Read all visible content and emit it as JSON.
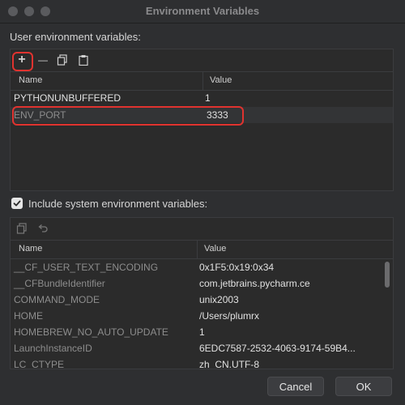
{
  "window": {
    "title": "Environment Variables"
  },
  "user_section": {
    "label": "User environment variables:",
    "toolbar": {
      "add": "+",
      "remove": "—",
      "copy": "copy",
      "paste": "paste"
    },
    "columns": {
      "name": "Name",
      "value": "Value"
    },
    "rows": [
      {
        "name": "PYTHONUNBUFFERED",
        "value": "1"
      },
      {
        "name": "ENV_PORT",
        "value": "3333"
      }
    ]
  },
  "system_section": {
    "checkbox_label": "Include system environment variables:",
    "checked": true,
    "columns": {
      "name": "Name",
      "value": "Value"
    },
    "rows": [
      {
        "name": "__CF_USER_TEXT_ENCODING",
        "value": "0x1F5:0x19:0x34"
      },
      {
        "name": "__CFBundleIdentifier",
        "value": "com.jetbrains.pycharm.ce"
      },
      {
        "name": "COMMAND_MODE",
        "value": "unix2003"
      },
      {
        "name": "HOME",
        "value": "/Users/plumrx"
      },
      {
        "name": "HOMEBREW_NO_AUTO_UPDATE",
        "value": "1"
      },
      {
        "name": "LaunchInstanceID",
        "value": "6EDC7587-2532-4063-9174-59B4..."
      },
      {
        "name": "LC_CTYPE",
        "value": "zh_CN.UTF-8"
      }
    ]
  },
  "buttons": {
    "cancel": "Cancel",
    "ok": "OK"
  },
  "colors": {
    "highlight": "#e0332f",
    "background": "#2e2f31"
  }
}
